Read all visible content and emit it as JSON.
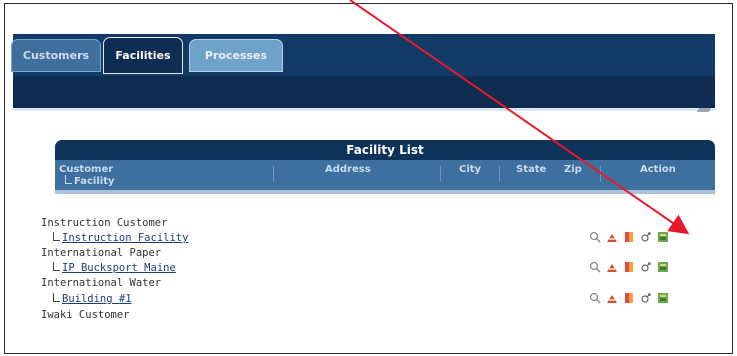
{
  "tabs": [
    {
      "label": "Customers"
    },
    {
      "label": "Facilities"
    },
    {
      "label": "Processes"
    }
  ],
  "facility_list": {
    "title": "Facility List",
    "columns": {
      "customer": "Customer",
      "facility": "Facility",
      "address": "Address",
      "city": "City",
      "state": "State",
      "zip": "Zip",
      "action": "Action"
    }
  },
  "rows": [
    {
      "customer": "Instruction Customer",
      "facility": "Instruction Facility"
    },
    {
      "customer": "International Paper",
      "facility": "IP Bucksport Maine"
    },
    {
      "customer": "International Water",
      "facility": "Building #1"
    },
    {
      "customer": "Iwaki Customer"
    }
  ],
  "action_icons": [
    "search-icon",
    "process-icon",
    "document-icon",
    "gender-icon",
    "report-icon"
  ],
  "colors": {
    "nav_dark": "#123a66",
    "header_mid": "#3d6f9f",
    "arrow": "#e8192c"
  }
}
